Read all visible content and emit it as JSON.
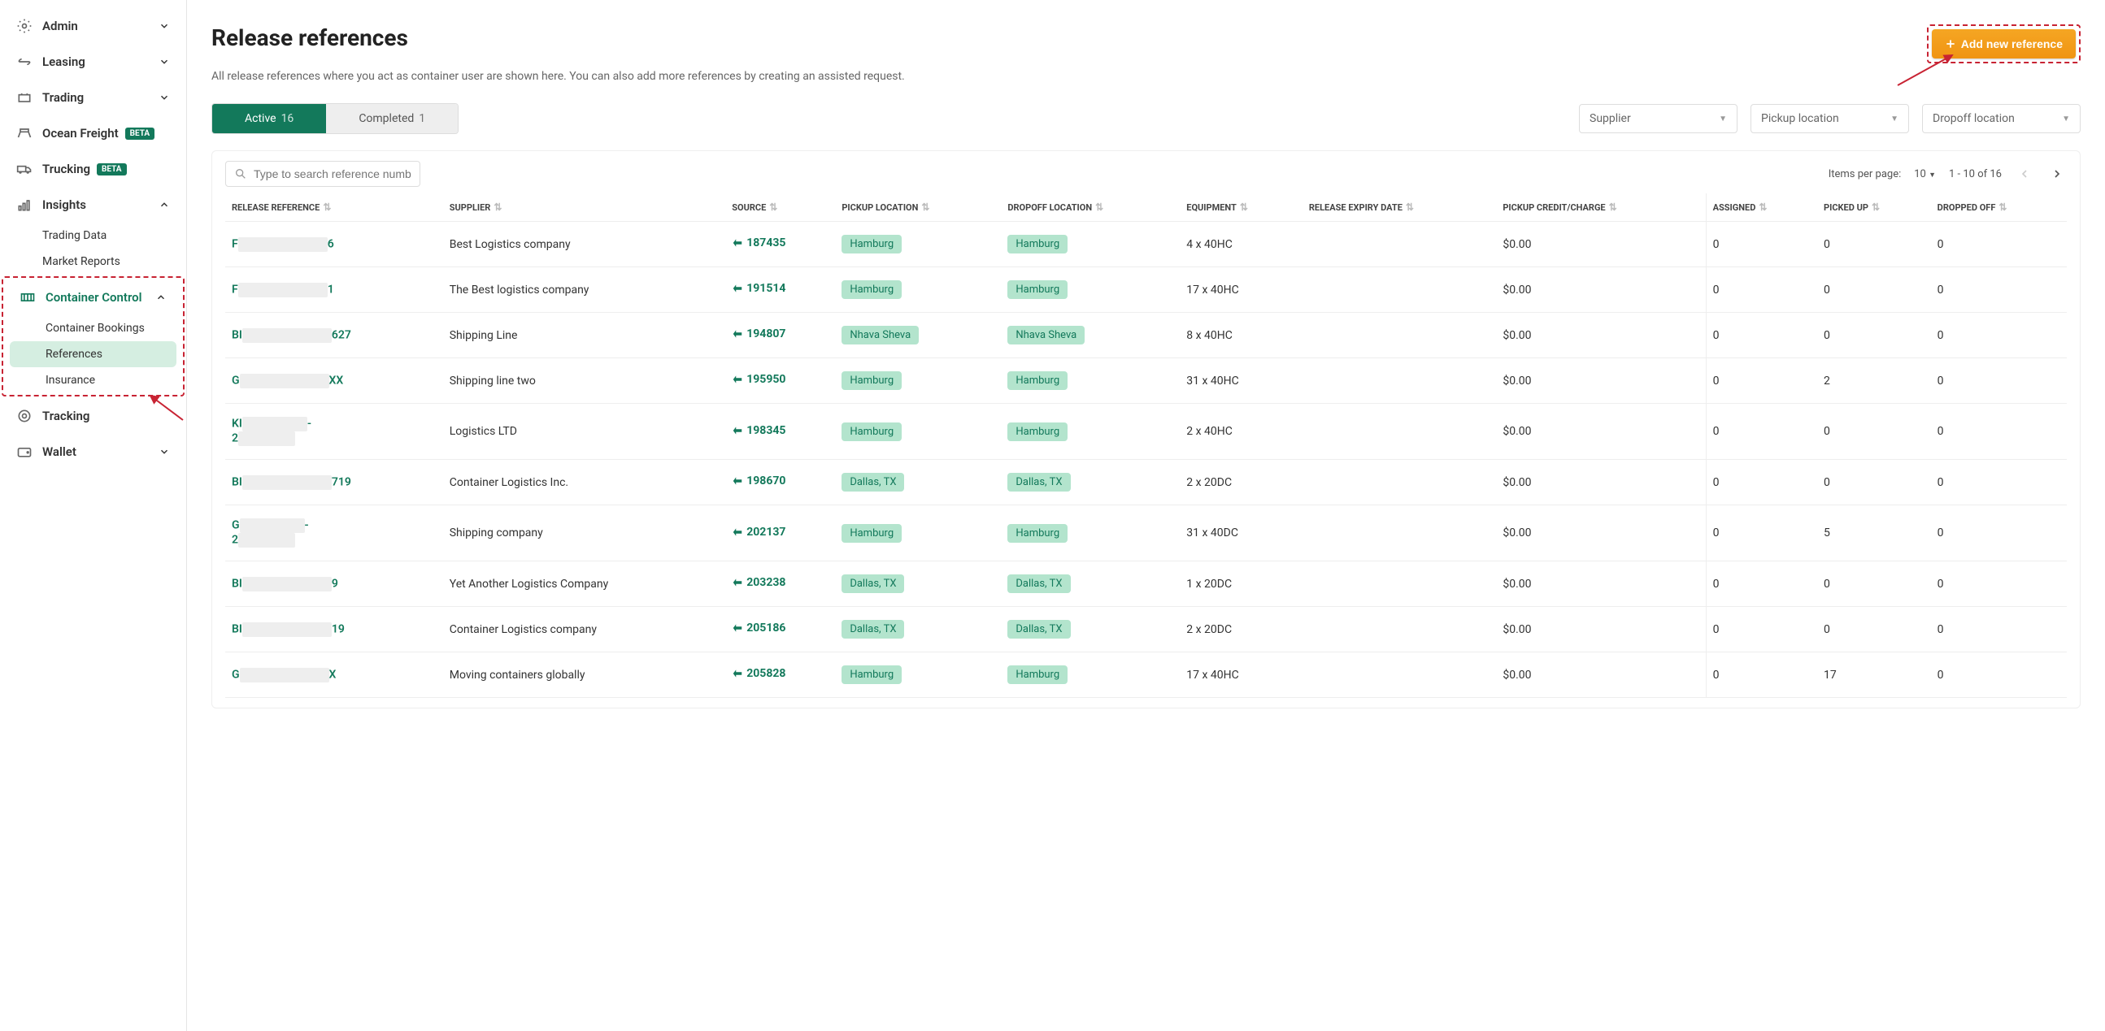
{
  "sidebar": {
    "items": [
      {
        "label": "Admin",
        "icon": "admin"
      },
      {
        "label": "Leasing",
        "icon": "leasing"
      },
      {
        "label": "Trading",
        "icon": "trading"
      },
      {
        "label": "Ocean Freight",
        "icon": "ocean",
        "badge": "BETA"
      },
      {
        "label": "Trucking",
        "icon": "trucking",
        "badge": "BETA"
      },
      {
        "label": "Insights",
        "icon": "insights",
        "expanded": true,
        "children": [
          "Trading Data",
          "Market Reports"
        ]
      },
      {
        "label": "Container Control",
        "icon": "container",
        "expanded": true,
        "active": true,
        "children_data": [
          {
            "label": "Container Bookings"
          },
          {
            "label": "References",
            "active": true
          },
          {
            "label": "Insurance"
          }
        ]
      },
      {
        "label": "Tracking",
        "icon": "tracking"
      },
      {
        "label": "Wallet",
        "icon": "wallet"
      }
    ]
  },
  "header": {
    "title": "Release references",
    "description": "All release references where you act as container user are shown here. You can also add more references by creating an assisted request.",
    "add_btn": "Add new reference"
  },
  "tabs": {
    "active_label": "Active",
    "active_count": "16",
    "completed_label": "Completed",
    "completed_count": "1"
  },
  "filters": {
    "supplier": "Supplier",
    "pickup": "Pickup location",
    "dropoff": "Dropoff location"
  },
  "table": {
    "search_placeholder": "Type to search reference number",
    "items_per_page_label": "Items per page:",
    "items_per_page_value": "10",
    "page_info": "1 - 10 of 16",
    "headers": {
      "ref": "RELEASE REFERENCE",
      "supplier": "SUPPLIER",
      "source": "SOURCE",
      "pickup": "PICKUP LOCATION",
      "dropoff": "DROPOFF LOCATION",
      "equipment": "EQUIPMENT",
      "expiry": "RELEASE EXPIRY DATE",
      "credit": "PICKUP CREDIT/CHARGE",
      "assigned": "ASSIGNED",
      "picked": "PICKED UP",
      "dropped": "DROPPED OFF"
    },
    "rows": [
      {
        "ref_pre": "F",
        "ref_suf": "6",
        "supplier": "Best Logistics company",
        "source": "187435",
        "pickup": "Hamburg",
        "dropoff": "Hamburg",
        "equipment": "4 x 40HC",
        "credit": "$0.00",
        "assigned": "0",
        "picked": "0",
        "dropped": "0"
      },
      {
        "ref_pre": "F",
        "ref_suf": "1",
        "supplier": "The Best logistics company",
        "source": "191514",
        "pickup": "Hamburg",
        "dropoff": "Hamburg",
        "equipment": "17 x 40HC",
        "credit": "$0.00",
        "assigned": "0",
        "picked": "0",
        "dropped": "0"
      },
      {
        "ref_pre": "BI",
        "ref_suf": "627",
        "supplier": "Shipping Line",
        "source": "194807",
        "pickup": "Nhava Sheva",
        "dropoff": "Nhava Sheva",
        "equipment": "8 x 40HC",
        "credit": "$0.00",
        "assigned": "0",
        "picked": "0",
        "dropped": "0"
      },
      {
        "ref_pre": "G",
        "ref_suf": "XX",
        "supplier": "Shipping line two",
        "source": "195950",
        "pickup": "Hamburg",
        "dropoff": "Hamburg",
        "equipment": "31 x 40HC",
        "credit": "$0.00",
        "assigned": "0",
        "picked": "2",
        "dropped": "0"
      },
      {
        "ref_pre": "KI",
        "ref_suf": "",
        "ref_pre2": "2",
        "supplier": "Logistics LTD",
        "source": "198345",
        "pickup": "Hamburg",
        "dropoff": "Hamburg",
        "equipment": "2 x 40HC",
        "credit": "$0.00",
        "assigned": "0",
        "picked": "0",
        "dropped": "0"
      },
      {
        "ref_pre": "BI",
        "ref_suf": "719",
        "supplier": "Container Logistics Inc.",
        "source": "198670",
        "pickup": "Dallas, TX",
        "dropoff": "Dallas, TX",
        "equipment": "2 x 20DC",
        "credit": "$0.00",
        "assigned": "0",
        "picked": "0",
        "dropped": "0"
      },
      {
        "ref_pre": "G",
        "ref_suf": "",
        "ref_pre2": "2",
        "supplier": "Shipping company",
        "source": "202137",
        "pickup": "Hamburg",
        "dropoff": "Hamburg",
        "equipment": "31 x 40DC",
        "credit": "$0.00",
        "assigned": "0",
        "picked": "5",
        "dropped": "0"
      },
      {
        "ref_pre": "BI",
        "ref_suf": "9",
        "supplier": "Yet Another Logistics Company",
        "source": "203238",
        "pickup": "Dallas, TX",
        "dropoff": "Dallas, TX",
        "equipment": "1 x 20DC",
        "credit": "$0.00",
        "assigned": "0",
        "picked": "0",
        "dropped": "0"
      },
      {
        "ref_pre": "BI",
        "ref_suf": "19",
        "supplier": "Container Logistics company",
        "source": "205186",
        "pickup": "Dallas, TX",
        "dropoff": "Dallas, TX",
        "equipment": "2 x 20DC",
        "credit": "$0.00",
        "assigned": "0",
        "picked": "0",
        "dropped": "0"
      },
      {
        "ref_pre": "G",
        "ref_suf": "X",
        "supplier": "Moving containers globally",
        "source": "205828",
        "pickup": "Hamburg",
        "dropoff": "Hamburg",
        "equipment": "17 x 40HC",
        "credit": "$0.00",
        "assigned": "0",
        "picked": "17",
        "dropped": "0"
      }
    ]
  }
}
